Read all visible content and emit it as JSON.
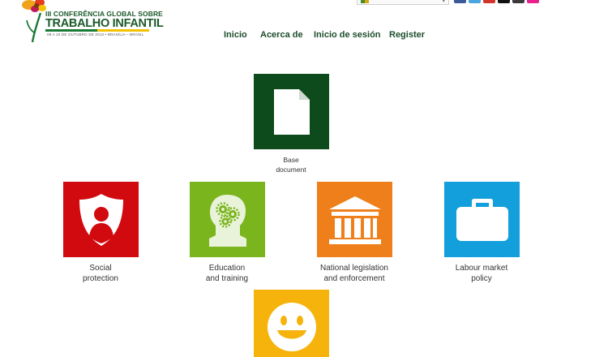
{
  "logo": {
    "line1": "III CONFERÊNCIA GLOBAL SOBRE",
    "line2": "TRABALHO INFANTIL",
    "line3": "08 A 10 DE OUTUBRO DE 2013 • BRASÍLIA – BRASIL"
  },
  "nav": {
    "items": [
      {
        "label": "Inicio"
      },
      {
        "label": "Acerca de"
      },
      {
        "label": "Inicio de sesión"
      },
      {
        "label": "Register"
      }
    ]
  },
  "tiles": {
    "base": {
      "line1": "Base",
      "line2": "document",
      "icon": "document-icon",
      "color": "#0d4a1c"
    },
    "social": {
      "line1": "Social",
      "line2": "protection",
      "icon": "shield-person-icon",
      "color": "#d10a10"
    },
    "education": {
      "line1": "Education",
      "line2": "and training",
      "icon": "head-gears-icon",
      "color": "#7ab51d"
    },
    "legislation": {
      "line1": "National legislation",
      "line2": "and enforcement",
      "icon": "courthouse-icon",
      "color": "#ee7f1a"
    },
    "labour": {
      "line1": "Labour market",
      "line2": "policy",
      "icon": "briefcase-icon",
      "color": "#129fdc"
    },
    "smile": {
      "icon": "smiley-icon",
      "color": "#f5b30c"
    }
  },
  "colors": {
    "nav_text": "#1d4d2b",
    "logo_green": "#1b5a2a",
    "logo_yellow": "#f2c200"
  }
}
